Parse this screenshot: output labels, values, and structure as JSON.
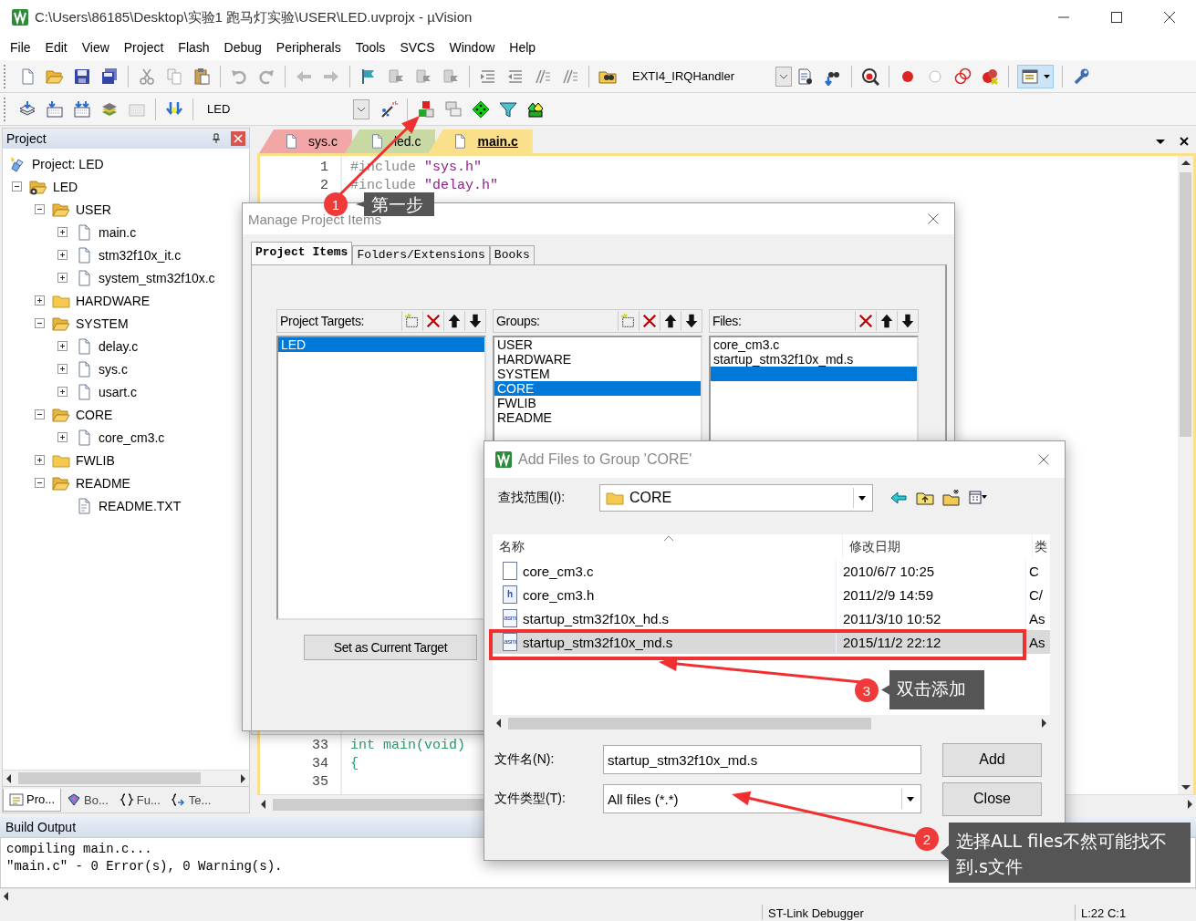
{
  "window": {
    "title": "C:\\Users\\86185\\Desktop\\实验1 跑马灯实验\\USER\\LED.uvprojx - µVision"
  },
  "menu": [
    "File",
    "Edit",
    "View",
    "Project",
    "Flash",
    "Debug",
    "Peripherals",
    "Tools",
    "SVCS",
    "Window",
    "Help"
  ],
  "toolbar": {
    "function_box": "EXTI4_IRQHandler",
    "target_box": "LED"
  },
  "project_panel": {
    "title": "Project",
    "tree": [
      {
        "label": "Project: LED",
        "kind": "project",
        "children": [
          {
            "label": "LED",
            "kind": "target",
            "expanded": true,
            "children": [
              {
                "label": "USER",
                "kind": "group",
                "expanded": true,
                "children": [
                  {
                    "label": "main.c",
                    "kind": "file",
                    "expanded": false
                  },
                  {
                    "label": "stm32f10x_it.c",
                    "kind": "file",
                    "expanded": false
                  },
                  {
                    "label": "system_stm32f10x.c",
                    "kind": "file",
                    "expanded": false
                  }
                ]
              },
              {
                "label": "HARDWARE",
                "kind": "group",
                "expanded": false
              },
              {
                "label": "SYSTEM",
                "kind": "group",
                "expanded": true,
                "children": [
                  {
                    "label": "delay.c",
                    "kind": "file",
                    "expanded": false
                  },
                  {
                    "label": "sys.c",
                    "kind": "file",
                    "expanded": false
                  },
                  {
                    "label": "usart.c",
                    "kind": "file",
                    "expanded": false
                  }
                ]
              },
              {
                "label": "CORE",
                "kind": "group",
                "expanded": true,
                "children": [
                  {
                    "label": "core_cm3.c",
                    "kind": "file",
                    "expanded": false
                  }
                ]
              },
              {
                "label": "FWLIB",
                "kind": "group",
                "expanded": false
              },
              {
                "label": "README",
                "kind": "group",
                "expanded": true,
                "children": [
                  {
                    "label": "README.TXT",
                    "kind": "text"
                  }
                ]
              }
            ]
          }
        ]
      }
    ],
    "tabs": [
      {
        "label": "Pro...",
        "kind": "project",
        "selected": true
      },
      {
        "label": "Bo...",
        "kind": "books",
        "selected": false
      },
      {
        "label": "Fu...",
        "kind": "functions",
        "selected": false
      },
      {
        "label": "Te...",
        "kind": "templates",
        "selected": false
      }
    ]
  },
  "editor": {
    "tabs": [
      {
        "label": "sys.c",
        "color": "#f2a6a6",
        "selected": false
      },
      {
        "label": "led.c",
        "color": "#c9d9a3",
        "selected": false
      },
      {
        "label": "main.c",
        "color": "#fbe08c",
        "selected": true
      }
    ],
    "lines": [
      {
        "number": "1",
        "tokens": [
          {
            "kind": "directive",
            "text": "#include"
          },
          {
            "kind": "string",
            "text": " \"sys.h\""
          }
        ]
      },
      {
        "number": "2",
        "tokens": [
          {
            "kind": "directive",
            "text": "#include"
          },
          {
            "kind": "string",
            "text": " \"delay.h\""
          }
        ]
      },
      {
        "number": "33",
        "tokens": [
          {
            "kind": "keyword",
            "text": "int main(void)"
          }
        ]
      },
      {
        "number": "34",
        "tokens": [
          {
            "kind": "keyword",
            "text": "{"
          }
        ]
      },
      {
        "number": "35"
      }
    ]
  },
  "build_output": {
    "title": "Build Output",
    "lines": [
      "compiling main.c...",
      "\"main.c\" - 0 Error(s), 0 Warning(s)."
    ]
  },
  "status_bar": [
    "ST-Link Debugger",
    "L:22 C:1"
  ],
  "manage_dialog": {
    "title": "Manage Project Items",
    "tabs": [
      {
        "label": "Project Items",
        "selected": true
      },
      {
        "label": "Folders/Extensions",
        "selected": false
      },
      {
        "label": "Books",
        "selected": false
      }
    ],
    "targets": {
      "label": "Project Targets:",
      "items": [
        {
          "label": "LED",
          "selected": true
        }
      ]
    },
    "groups": {
      "label": "Groups:",
      "items": [
        {
          "label": "USER",
          "selected": false
        },
        {
          "label": "HARDWARE",
          "selected": false
        },
        {
          "label": "SYSTEM",
          "selected": false
        },
        {
          "label": "CORE",
          "selected": true
        },
        {
          "label": "FWLIB",
          "selected": false
        },
        {
          "label": "README",
          "selected": false
        }
      ]
    },
    "files": {
      "label": "Files:",
      "items": [
        {
          "label": "core_cm3.c",
          "selected": false
        },
        {
          "label": "startup_stm32f10x_md.s",
          "selected": false
        }
      ],
      "new_entry_selected": true
    },
    "set_target_button": "Set as Current Target"
  },
  "add_dialog": {
    "title": "Add Files to Group 'CORE'",
    "look_in_label": "查找范围(I):",
    "look_in_value": "CORE",
    "columns": [
      "名称",
      "修改日期",
      "类"
    ],
    "rows": [
      {
        "name": "core_cm3.c",
        "date": "2010/6/7 10:25",
        "type": "C",
        "kind": "source",
        "selected": false
      },
      {
        "name": "core_cm3.h",
        "date": "2011/2/9 14:59",
        "type": "C/",
        "kind": "header",
        "icon_text": "h",
        "selected": false
      },
      {
        "name": "startup_stm32f10x_hd.s",
        "date": "2011/3/10 10:52",
        "type": "As",
        "kind": "asm",
        "icon_text": "asm",
        "selected": false
      },
      {
        "name": "startup_stm32f10x_md.s",
        "date": "2015/11/2 22:12",
        "type": "As",
        "kind": "asm",
        "icon_text": "asm",
        "selected": true
      }
    ],
    "filename_label": "文件名(N):",
    "filename_value": "startup_stm32f10x_md.s",
    "filetype_label": "文件类型(T):",
    "filetype_value": "All files (*.*)",
    "buttons": [
      "Add",
      "Close"
    ]
  },
  "annotations": [
    {
      "number": "1",
      "text": "第一步"
    },
    {
      "number": "3",
      "text": "双击添加"
    },
    {
      "number": "2",
      "text": "选择ALL files不然可能找不到.s文件"
    }
  ]
}
